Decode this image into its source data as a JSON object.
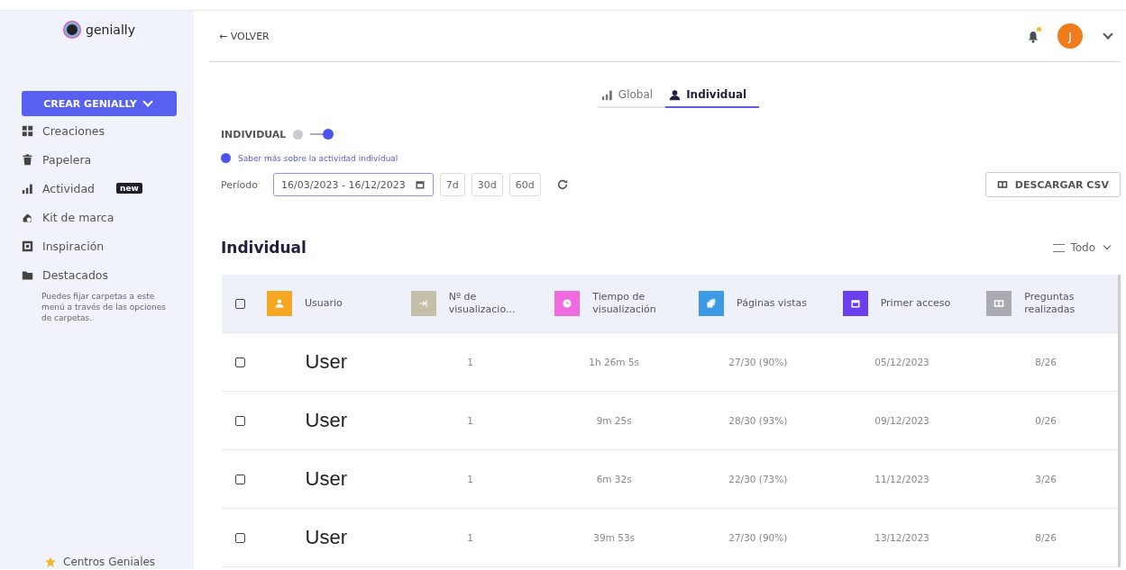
{
  "sidebar": {
    "logo": "genially",
    "create_button": "CREAR GENIALLY",
    "items": [
      {
        "kind": "grid",
        "label": "Creaciones"
      },
      {
        "kind": "trash",
        "label": "Papelera"
      },
      {
        "kind": "bars",
        "label": "Actividad",
        "badge": "new"
      },
      {
        "kind": "kit",
        "label": "Kit de marca"
      },
      {
        "kind": "frame",
        "label": "Inspiración"
      },
      {
        "kind": "folder",
        "label": "Destacados"
      }
    ],
    "hint": "Puedes fijar carpetas a este menú a través de las opciones de carpetas.",
    "footer_item": "Centros Geniales"
  },
  "header": {
    "back": "← VOLVER",
    "notification": true,
    "avatar": "J"
  },
  "tabs": [
    {
      "kind": "bars",
      "label": "Global",
      "selected": false
    },
    {
      "kind": "person",
      "label": "Individual",
      "selected": true
    }
  ],
  "toggle": {
    "label": "INDIVIDUAL",
    "on": true
  },
  "help_link": "Saber más sobre la actividad individual",
  "period": {
    "label": "Período",
    "value": "16/03/2023 - 16/12/2023",
    "presets": [
      "7d",
      "30d",
      "60d"
    ]
  },
  "download_button": "DESCARGAR CSV",
  "section_title": "Individual",
  "filter": "Todo",
  "table": {
    "header_checked": false,
    "columns": [
      {
        "kind": "user",
        "label": "Usuario",
        "color": "#f5a623"
      },
      {
        "kind": "enter",
        "label": "Nº de visualizacio...",
        "color": "#c4bfa8"
      },
      {
        "kind": "clock",
        "label": "Tiempo de visualización",
        "color": "#f06adf"
      },
      {
        "kind": "pages",
        "label": "Páginas vistas",
        "color": "#3d9be6"
      },
      {
        "kind": "calendar",
        "label": "Primer acceso",
        "color": "#6a3ff0"
      },
      {
        "kind": "card",
        "label": "Preguntas realizadas",
        "color": "#a9abb1"
      }
    ],
    "rows": [
      {
        "checked": false,
        "cells": [
          "User",
          "1",
          "1h 26m 5s",
          "27/30 (90%)",
          "05/12/2023",
          "8/26"
        ]
      },
      {
        "checked": false,
        "cells": [
          "User",
          "1",
          "9m 25s",
          "28/30 (93%)",
          "09/12/2023",
          "0/26"
        ]
      },
      {
        "checked": false,
        "cells": [
          "User",
          "1",
          "6m 32s",
          "22/30 (73%)",
          "11/12/2023",
          "3/26"
        ]
      },
      {
        "checked": false,
        "cells": [
          "User",
          "1",
          "39m 53s",
          "27/30 (90%)",
          "13/12/2023",
          "8/26"
        ]
      }
    ]
  }
}
